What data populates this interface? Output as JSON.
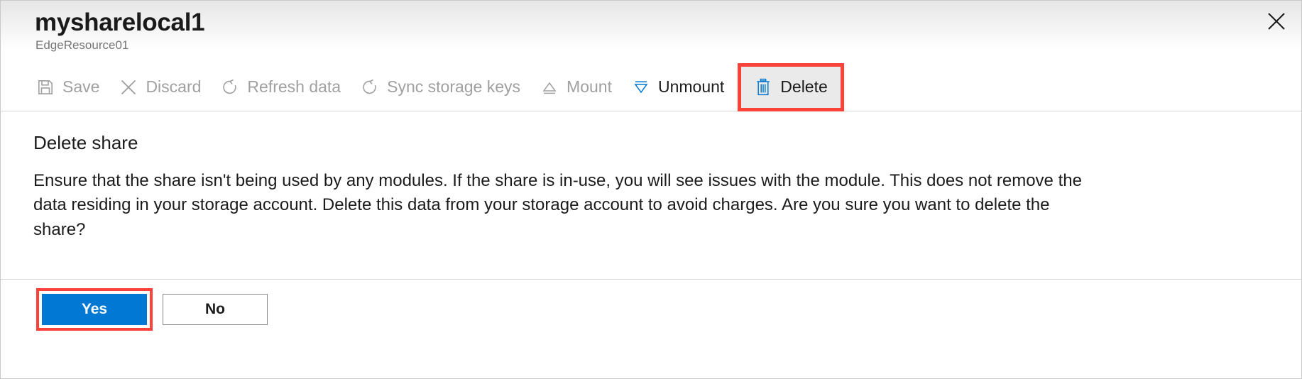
{
  "header": {
    "title": "mysharelocal1",
    "subtitle": "EdgeResource01",
    "close_icon": "close-icon"
  },
  "toolbar": {
    "items": [
      {
        "label": "Save",
        "icon": "save-icon",
        "enabled": false,
        "highlighted": false
      },
      {
        "label": "Discard",
        "icon": "discard-x-icon",
        "enabled": false,
        "highlighted": false
      },
      {
        "label": "Refresh data",
        "icon": "refresh-icon",
        "enabled": false,
        "highlighted": false
      },
      {
        "label": "Sync storage keys",
        "icon": "sync-icon",
        "enabled": false,
        "highlighted": false
      },
      {
        "label": "Mount",
        "icon": "mount-eject-icon",
        "enabled": false,
        "highlighted": false
      },
      {
        "label": "Unmount",
        "icon": "unmount-icon",
        "enabled": true,
        "highlighted": false
      },
      {
        "label": "Delete",
        "icon": "trash-icon",
        "enabled": true,
        "highlighted": true
      }
    ]
  },
  "main": {
    "heading": "Delete share",
    "body": "Ensure that the share isn't being used by any modules. If the share is in-use, you will see issues with the module. This does not remove the data residing in your storage account. Delete this data from your storage account to avoid charges. Are you sure you want to delete the share?"
  },
  "footer": {
    "confirm_label": "Yes",
    "cancel_label": "No"
  },
  "colors": {
    "accent_blue": "#0078d4",
    "highlight_red": "#f9423a",
    "disabled_gray": "#a0a0a0",
    "text": "#1b1b1b",
    "subtitle_gray": "#767676"
  }
}
